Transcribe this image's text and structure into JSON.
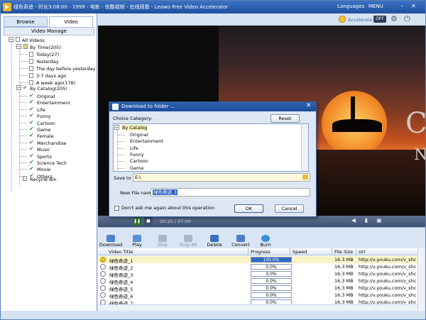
{
  "window": {
    "title": "绿色奇迹 - 时长3:08:00 - 1999 - 电影 - 优酷视频 - 在线观看 - Leawo Free Video Accelerator",
    "languages_label": "Languages",
    "menu_label": "MENU",
    "minimize": "–",
    "close": "✕"
  },
  "accelerate": {
    "label": "Accelerate",
    "toggle": "OFF"
  },
  "left_tabs": [
    "Browse",
    "Video"
  ],
  "video_manage": "Video Manage",
  "tree": {
    "root": "All Videos",
    "by_time": "By Time(205)",
    "time_items": [
      "Today(27)",
      "Yesterday",
      "The day before yesterday",
      "3-7 days ago",
      "A week ago(178)"
    ],
    "by_catalog": "By Catalog(205)",
    "catalog_items": [
      "Original",
      "Entertainment",
      "Life",
      "Funny",
      "Cartoon",
      "Game",
      "Female",
      "Merchandise",
      "Music",
      "Sports",
      "Science Tech",
      "Movie",
      "Others"
    ],
    "recycle": "Recycle Bin"
  },
  "video": {
    "title_text_1": "CK",
    "title_text_2": "NT",
    "time": "00:25 / 07:00"
  },
  "toolbar": [
    "Download",
    "Play",
    "Stop",
    "Stop All",
    "Delete",
    "Convert",
    "Burn"
  ],
  "list": {
    "columns": [
      "Video Title",
      "Progress",
      "Speed",
      "File Size",
      "Url"
    ],
    "rows": [
      {
        "title": "绿色奇迹_1",
        "progress": "100.0%",
        "size": "16.3 MB",
        "url": "http://v.youku.com/v_shc"
      },
      {
        "title": "绿色奇迹_2",
        "progress": "0.0%",
        "size": "16.3 MB",
        "url": "http://v.youku.com/v_shc"
      },
      {
        "title": "绿色奇迹_3",
        "progress": "0.0%",
        "size": "16.3 MB",
        "url": "http://v.youku.com/v_shc"
      },
      {
        "title": "绿色奇迹_4",
        "progress": "0.0%",
        "size": "16.3 MB",
        "url": "http://v.youku.com/v_shc"
      },
      {
        "title": "绿色奇迹_5",
        "progress": "0.0%",
        "size": "16.3 MB",
        "url": "http://v.youku.com/v_shc"
      },
      {
        "title": "绿色奇迹_6",
        "progress": "0.0%",
        "size": "16.3 MB",
        "url": "http://v.youku.com/v_shc"
      },
      {
        "title": "绿色奇迹_7",
        "progress": "0.0%",
        "size": "16.3 MB",
        "url": "http://v.youku.com/v_shc"
      }
    ]
  },
  "dialog": {
    "title": "Download to folder ...",
    "choice_label": "Choice Category:",
    "reset": "Reset",
    "categories": [
      "By Catalog",
      "Original",
      "Entertainment",
      "Life",
      "Funny",
      "Cartoon",
      "Game"
    ],
    "save_to_label": "Save to",
    "save_to_value": "E:\\",
    "file_name_label": "New File name",
    "file_name_value": "绿色奇迹_1",
    "dont_ask": "Don't ask me again about this operation",
    "ok": "OK",
    "cancel": "Cancel"
  }
}
